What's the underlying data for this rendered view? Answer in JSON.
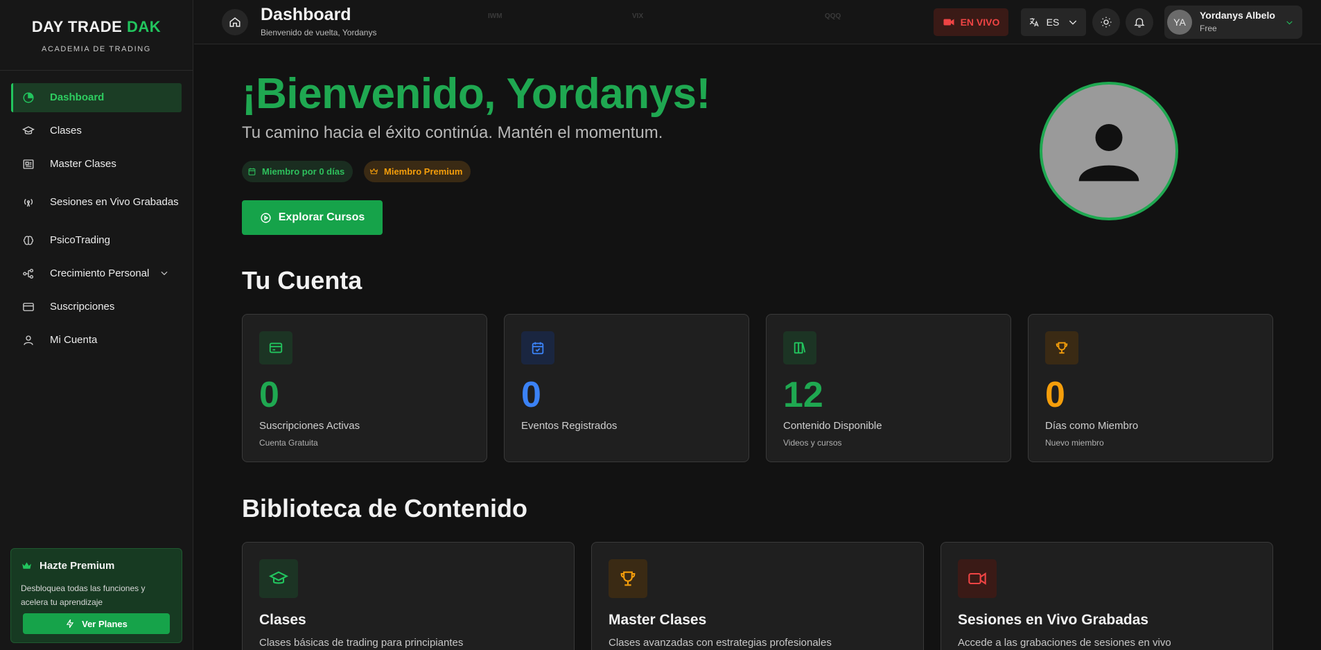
{
  "brand": {
    "title_main": "DAY TRADE",
    "title_accent": "DAK",
    "subtitle": "ACADEMIA DE TRADING"
  },
  "sidebar": {
    "items": [
      {
        "label": "Dashboard",
        "icon": "dashboard-icon"
      },
      {
        "label": "Clases",
        "icon": "graduation-cap-icon"
      },
      {
        "label": "Master Clases",
        "icon": "presentation-icon"
      },
      {
        "label": "Sesiones en Vivo Grabadas",
        "icon": "broadcast-icon"
      },
      {
        "label": "PsicoTrading",
        "icon": "brain-icon"
      },
      {
        "label": "Crecimiento Personal",
        "icon": "growth-icon"
      },
      {
        "label": "Suscripciones",
        "icon": "credit-card-icon"
      },
      {
        "label": "Mi Cuenta",
        "icon": "user-icon"
      }
    ],
    "premium": {
      "title": "Hazte Premium",
      "description": "Desbloquea todas las funciones y acelera tu aprendizaje",
      "button": "Ver Planes"
    }
  },
  "header": {
    "title": "Dashboard",
    "subtitle": "Bienvenido de vuelta, Yordanys",
    "live_label": "EN VIVO",
    "language": "ES",
    "user": {
      "initials": "YA",
      "name": "Yordanys Albelo",
      "plan": "Free"
    },
    "tickers": [
      "IWM",
      "VIX",
      "QQQ"
    ]
  },
  "hero": {
    "title": "¡Bienvenido, Yordanys!",
    "subtitle": "Tu camino hacia el éxito continúa. Mantén el momentum.",
    "chip_member_days": "Miembro por 0 días",
    "chip_premium": "Miembro Premium",
    "explore_button": "Explorar Cursos"
  },
  "account": {
    "title": "Tu Cuenta",
    "stats": [
      {
        "value": "0",
        "label": "Suscripciones Activas",
        "note": "Cuenta Gratuita",
        "color": "#1fa851"
      },
      {
        "value": "0",
        "label": "Eventos Registrados",
        "note": "",
        "color": "#3b82f6"
      },
      {
        "value": "12",
        "label": "Contenido Disponible",
        "note": "Videos y cursos",
        "color": "#1fa851"
      },
      {
        "value": "0",
        "label": "Días como Miembro",
        "note": "Nuevo miembro",
        "color": "#f59e0b"
      }
    ]
  },
  "library": {
    "title": "Biblioteca de Contenido",
    "cards": [
      {
        "title": "Clases",
        "description": "Clases básicas de trading para principiantes"
      },
      {
        "title": "Master Clases",
        "description": "Clases avanzadas con estrategias profesionales"
      },
      {
        "title": "Sesiones en Vivo Grabadas",
        "description": "Accede a las grabaciones de sesiones en vivo"
      }
    ]
  },
  "colors": {
    "accent": "#22c55e",
    "blue": "#3b82f6",
    "orange": "#f59e0b",
    "red": "#ef4444"
  }
}
